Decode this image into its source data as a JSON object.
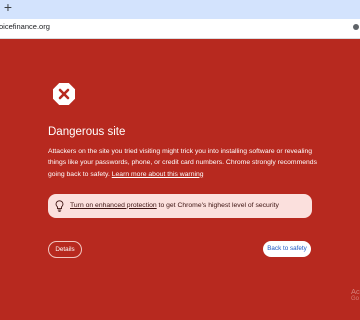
{
  "browser": {
    "new_tab_symbol": "+",
    "url": "oicefinance.org"
  },
  "warning": {
    "icon": "warning-octagon-x-icon",
    "title": "Dangerous site",
    "body": "Attackers on the site you tried visiting might trick you into installing software or revealing things like your passwords, phone, or credit card numbers. Chrome strongly recommends going back to safety.",
    "learn_more_link": "Learn more about this warning",
    "protection_link": "Turn on enhanced protection",
    "protection_text": " to get Chrome's highest level of security",
    "details_button": "Details",
    "back_button": "Back to safety"
  },
  "watermark": {
    "line1": "Ac",
    "line2": "Go"
  },
  "colors": {
    "background": "#b7291f",
    "tabstrip": "#d3e3fd",
    "protection_box": "#fbe0dd",
    "back_button_text": "#1a56c4"
  }
}
